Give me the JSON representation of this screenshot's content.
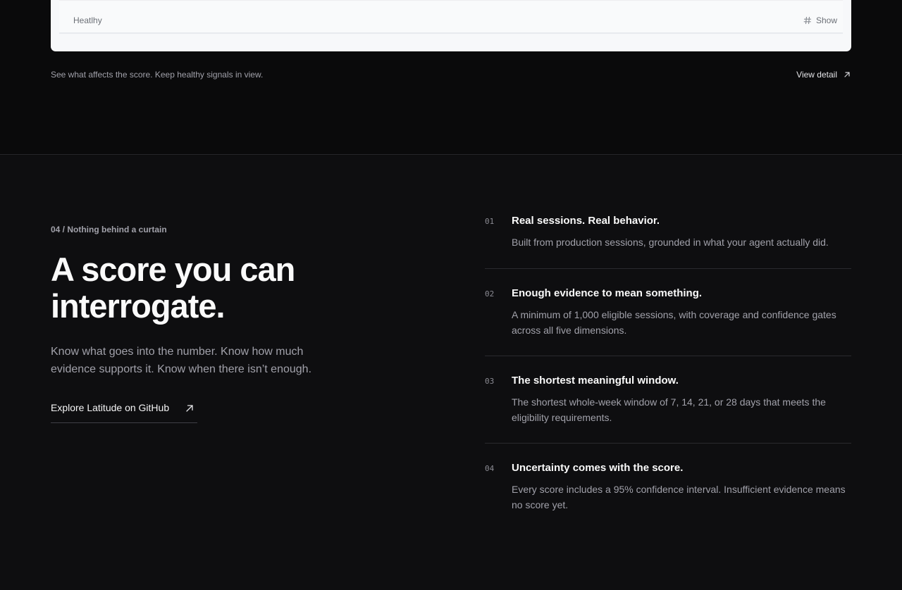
{
  "top": {
    "card": {
      "label": "Heatlhy",
      "toggle_label": "Show"
    },
    "caption": "See what affects the score. Keep healthy signals in view.",
    "view_detail_label": "View detail"
  },
  "main": {
    "eyebrow": "04 / Nothing behind a curtain",
    "headline": "A score you can interrogate.",
    "lead": "Know what goes into the number. Know how much evidence supports it. Know when there isn’t enough.",
    "github_link_label": "Explore Latitude on GitHub",
    "features": [
      {
        "num": "01",
        "title": "Real sessions. Real behavior.",
        "desc": "Built from production sessions, grounded in what your agent actually did."
      },
      {
        "num": "02",
        "title": "Enough evidence to mean something.",
        "desc": "A minimum of 1,000 eligible sessions, with coverage and confidence gates across all five dimensions."
      },
      {
        "num": "03",
        "title": "The shortest meaningful window.",
        "desc": "The shortest whole-week window of 7, 14, 21, or 28 days that meets the eligibility requirements."
      },
      {
        "num": "04",
        "title": "Uncertainty comes with the score.",
        "desc": "Every score includes a 95% confidence interval. Insufficient evidence means no score yet."
      }
    ]
  },
  "icons": {
    "toggle": "hash-icon",
    "view_detail": "arrow-up-right-icon",
    "github_link": "arrow-up-right-icon"
  }
}
